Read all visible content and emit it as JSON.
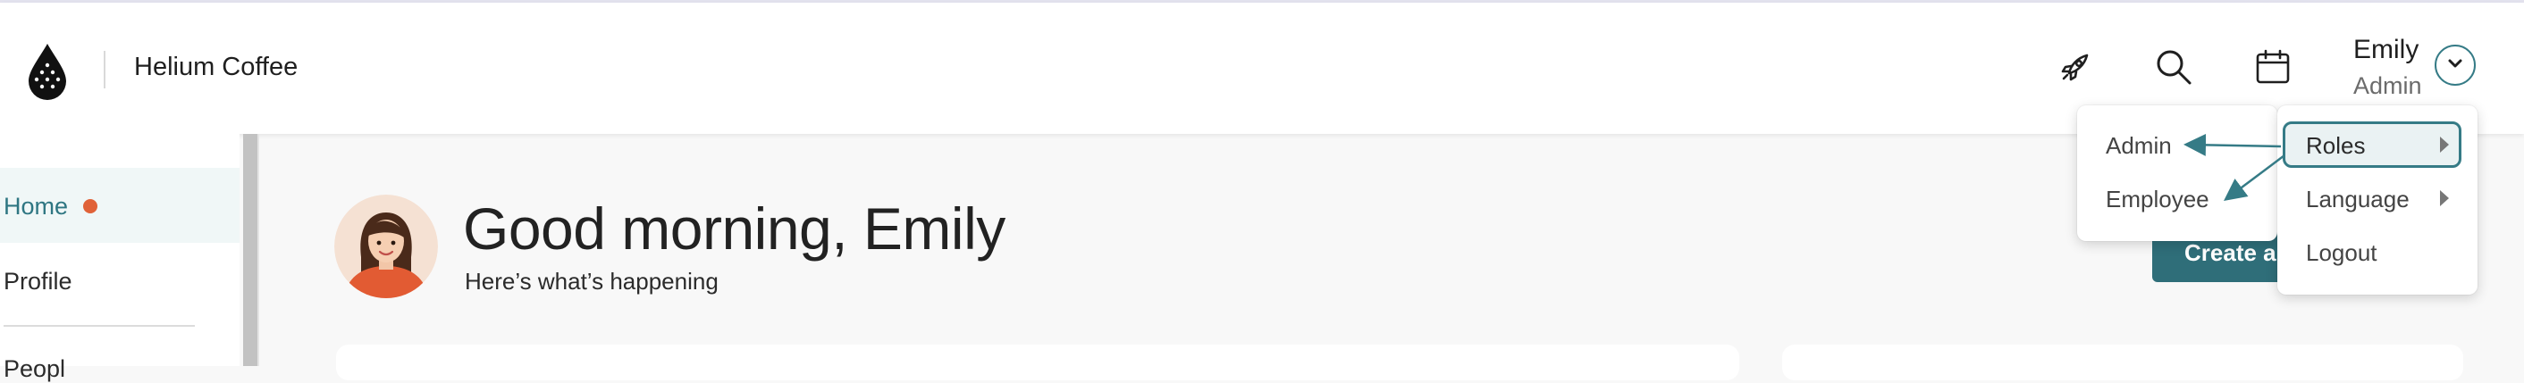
{
  "header": {
    "brand": "Helium Coffee",
    "user": {
      "name": "Emily",
      "role": "Admin"
    },
    "icons": [
      "rocket-icon",
      "search-icon",
      "calendar-icon",
      "chevron-down-icon"
    ]
  },
  "sidebar": {
    "items": [
      {
        "label": "Home",
        "active": true,
        "notification": true
      },
      {
        "label": "Profile"
      },
      {
        "label": "Peopl"
      }
    ]
  },
  "main": {
    "greeting": "Good morning, Emily",
    "subtitle": "Here’s what’s happening",
    "create_button": "Create a"
  },
  "user_menu": {
    "items": [
      {
        "label": "Roles",
        "has_submenu": true,
        "highlighted": true
      },
      {
        "label": "Language",
        "has_submenu": true
      },
      {
        "label": "Logout"
      }
    ]
  },
  "roles_submenu": {
    "items": [
      {
        "label": "Admin"
      },
      {
        "label": "Employee"
      }
    ]
  },
  "colors": {
    "accent": "#357b86",
    "button": "#2f6e79",
    "notification_dot": "#e06238",
    "active_nav_bg": "#f0f7f7"
  }
}
